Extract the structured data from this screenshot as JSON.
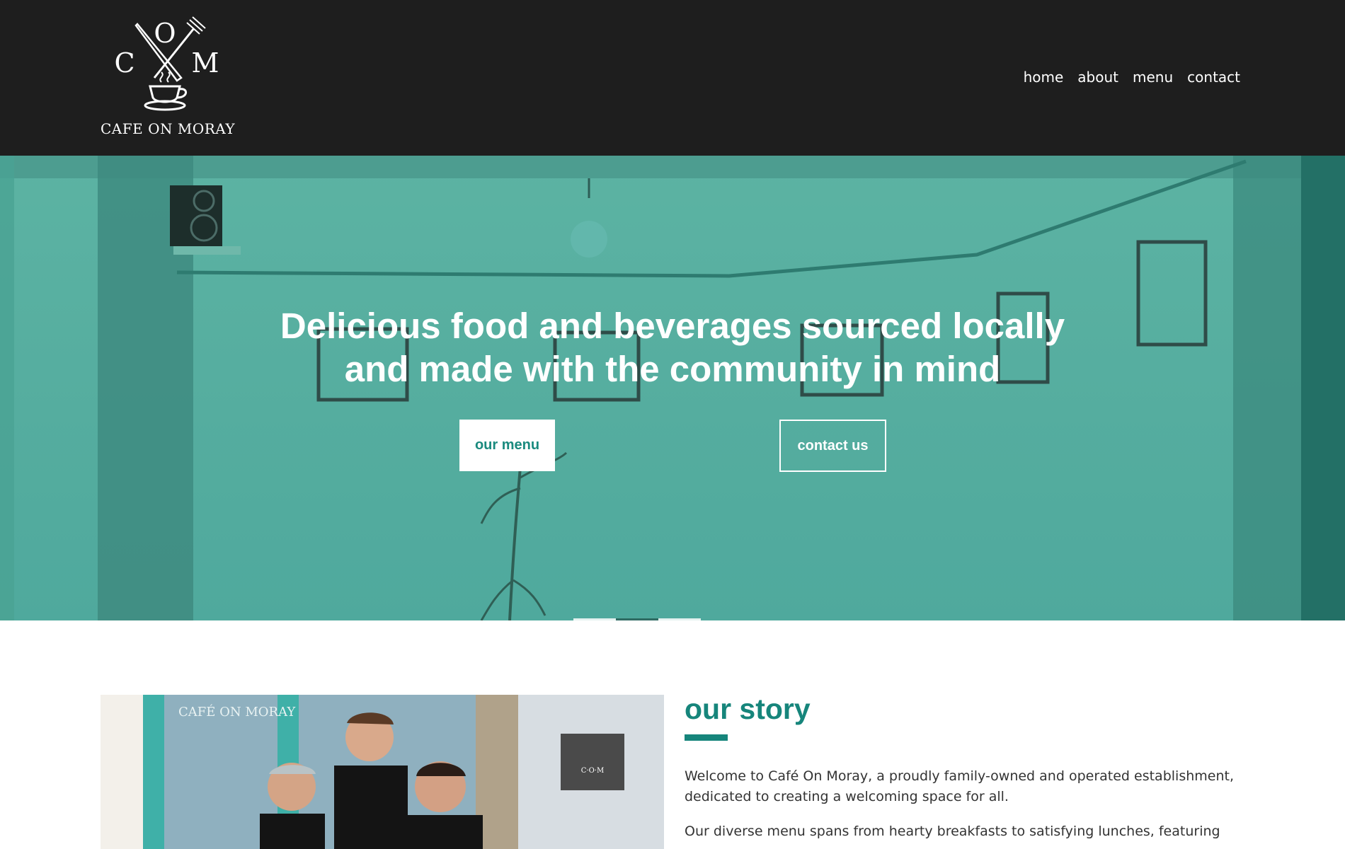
{
  "brand": {
    "logo_text": "CAFE ON MORAY",
    "monogram": {
      "top": "O",
      "left": "C",
      "right": "M"
    }
  },
  "nav": {
    "items": [
      {
        "label": "home"
      },
      {
        "label": "about"
      },
      {
        "label": "menu"
      },
      {
        "label": "contact"
      }
    ]
  },
  "hero": {
    "headline_line1": "Delicious food and beverages sourced locally",
    "headline_line2": "and made with the community in mind",
    "buttons": {
      "menu_label": "our menu",
      "contact_label": "contact us"
    },
    "slide_count": 3,
    "active_slide": 2
  },
  "story": {
    "title": "our story",
    "paragraphs": [
      "Welcome to Café On Moray, a proudly family-owned and operated establishment, dedicated to creating a welcoming space for all.",
      "Our diverse menu spans from hearty breakfasts to satisfying lunches, featuring"
    ],
    "photo_sign_text": "CAFÉ ON MORAY"
  },
  "colors": {
    "header_bg": "#1e1e1e",
    "teal_overlay": "#55ad9f",
    "accent": "#16857b",
    "text": "#333333"
  },
  "icons": {
    "logo": "fork-knife-coffee-cup-icon"
  }
}
